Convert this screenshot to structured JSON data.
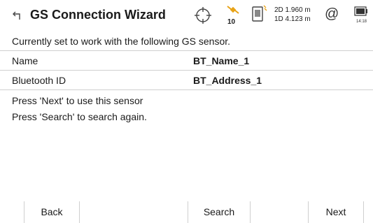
{
  "header": {
    "title": "GS Connection Wizard",
    "satellite_count": "10",
    "quality_2d": "2D 1.960 m",
    "quality_1d": "1D 4.123 m",
    "at_symbol": "@",
    "clock": "14:18"
  },
  "intro": "Currently set to work with the following GS sensor.",
  "fields": [
    {
      "label": "Name",
      "value": "BT_Name_1"
    },
    {
      "label": "Bluetooth ID",
      "value": "BT_Address_1"
    }
  ],
  "messages": [
    "Press 'Next' to use this sensor",
    "Press 'Search' to search again."
  ],
  "softkeys": {
    "back": "Back",
    "search": "Search",
    "next": "Next"
  },
  "icons": {
    "back": "back-arrow-icon",
    "gnss": "gnss-crosshair-icon",
    "satellite": "satellite-icon",
    "gs_sensor": "gs-sensor-icon",
    "battery": "battery-icon"
  },
  "colors": {
    "satellite_accent": "#e8a317",
    "divider": "#cfcfcf"
  }
}
